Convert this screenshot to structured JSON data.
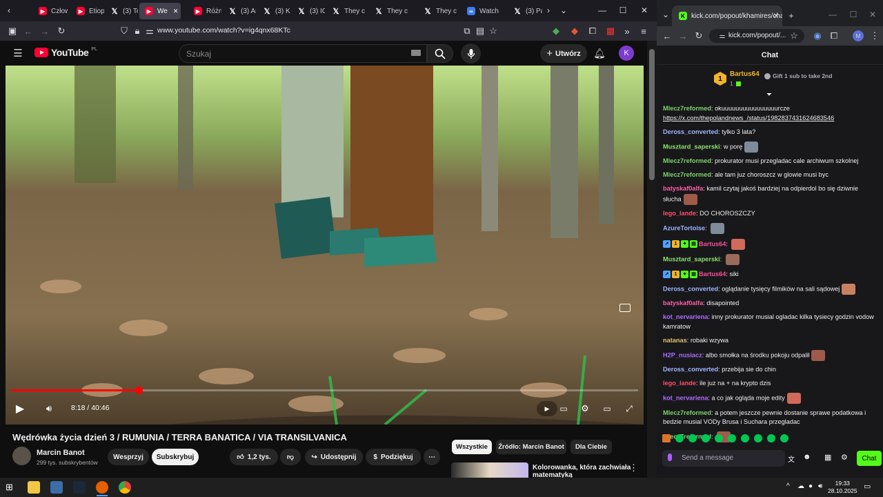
{
  "firefox": {
    "tabs": [
      {
        "label": "Człow",
        "icon": "youtube-icon"
      },
      {
        "label": "Etiop",
        "icon": "youtube-icon"
      },
      {
        "label": "(3) To",
        "icon": "x-icon"
      },
      {
        "label": "We",
        "icon": "youtube-icon",
        "active": true
      },
      {
        "label": "Różni",
        "icon": "youtube-icon"
      },
      {
        "label": "(3) Ar",
        "icon": "x-icon"
      },
      {
        "label": "(3) Ko",
        "icon": "x-icon"
      },
      {
        "label": "(3) IC",
        "icon": "x-icon"
      },
      {
        "label": "They c",
        "icon": "x-icon"
      },
      {
        "label": "They c",
        "icon": "x-icon"
      },
      {
        "label": "They c",
        "icon": "x-icon"
      },
      {
        "label": "Watch",
        "icon": "watch-icon"
      },
      {
        "label": "(3) Pa",
        "icon": "x-icon"
      }
    ],
    "url": "www.youtube.com/watch?v=ig4qnx68KTc"
  },
  "youtube": {
    "logo_text": "YouTube",
    "logo_region": "PL",
    "search_placeholder": "Szukaj",
    "create_label": "Utwórz",
    "avatar_letter": "K",
    "video": {
      "current_time": "8:18",
      "separator": " / ",
      "duration": "40:46",
      "progress_fraction": 0.203
    },
    "title": "Wędrówka życia dzień 3 / RUMUNIA / TERRA BANATICA / VIA TRANSILVANICA",
    "channel": {
      "name": "Marcin Banot",
      "subs": "299 tys. subskrybentów"
    },
    "buttons": {
      "support": "Wesprzyj",
      "subscribe": "Subskrybuj",
      "likes": "1,2 tys.",
      "share": "Udostępnij",
      "thanks": "Podziękuj"
    },
    "chips": [
      "Wszystkie",
      "Źródło: Marcin Banot",
      "Dla Ciebie"
    ],
    "recommended_title": "Kolorowanka, która zachwiała",
    "recommended_title2": "matematyką"
  },
  "chrome": {
    "tab_title": "kick.com/popout/khamires/cha",
    "url": "kick.com/popout/..."
  },
  "chat": {
    "header": "Chat",
    "pinned_user": "Bartus64",
    "pinned_count": "1",
    "pinned_text": "Gift 1 sub to take 2nd",
    "messages": [
      {
        "user": "Mlecz7reformed",
        "color": "#7dd36b",
        "text": "okuuuuuuuuuuuuuuuurcze",
        "link": "https://x.com/thepolandnews_/status/1982837431624683546"
      },
      {
        "user": "Deross_converted",
        "color": "#9fb6ff",
        "text": "tylko 3 lata?"
      },
      {
        "user": "Musztard_saperski",
        "color": "#8fe26f",
        "text": "w porę",
        "emote": true
      },
      {
        "user": "Mlecz7reformed",
        "color": "#7dd36b",
        "text": "prokurator musi przegladac cale archiwum szkolnej"
      },
      {
        "user": "Mlecz7reformed",
        "color": "#7dd36b",
        "text": "ale tam juz choroszcz w glowie musi byc"
      },
      {
        "user": "batyskaf0alfa",
        "color": "#ff5fa8",
        "text": "kamil czytaj jakoś bardziej na odpierdol bo się dziwnie słucha",
        "emote": true
      },
      {
        "user": "lego_lande",
        "color": "#ff4d6d",
        "text": "DO CHOROSZCZY"
      },
      {
        "user": "AzureTortoise",
        "color": "#9fb6ff",
        "text": "",
        "emote": true
      },
      {
        "user": "Bartus64",
        "color": "#ff4d9a",
        "text": "",
        "emote": true,
        "badges": true
      },
      {
        "user": "Musztard_saperski",
        "color": "#8fe26f",
        "text": "",
        "emote": true
      },
      {
        "user": "Bartus64",
        "color": "#ff4d9a",
        "text": "siki",
        "badges": true
      },
      {
        "user": "Deross_converted",
        "color": "#9fb6ff",
        "text": "oglądanie tysięcy filmików na sali sądowej",
        "emote": true
      },
      {
        "user": "batyskaf0alfa",
        "color": "#ff5fa8",
        "text": "disapointed"
      },
      {
        "user": "kot_nervariena",
        "color": "#b06cff",
        "text": "inny prokurator musial ogladac kilka tysiecy godzin vodow kamratow"
      },
      {
        "user": "natanas",
        "color": "#e0c36a",
        "text": "robaki wzywa"
      },
      {
        "user": "H2P_nusiacz",
        "color": "#b06cff",
        "text": "albo smołka na środku pokoju odpalił",
        "emote": true
      },
      {
        "user": "Deross_converted",
        "color": "#9fb6ff",
        "text": "przebija sie do chin"
      },
      {
        "user": "lego_lande",
        "color": "#ff4d6d",
        "text": "ile juz na + na krypto dzis"
      },
      {
        "user": "kot_nervariena",
        "color": "#b06cff",
        "text": "a co jak ogląda moje edity",
        "emote": true
      },
      {
        "user": "Mlecz7reformed",
        "color": "#7dd36b",
        "text": "a potem jeszcze pewnie dostanie sprawe podatkowa i bedzie musial VODy Brusa i Suchara przegladac"
      },
      {
        "user": "Mlecz7reformed",
        "color": "#7dd36b",
        "text": "",
        "emote": true
      }
    ],
    "input_placeholder": "Send a message",
    "send_label": "Chat"
  },
  "taskbar": {
    "time": "19:33",
    "date": "28.10.2025"
  }
}
